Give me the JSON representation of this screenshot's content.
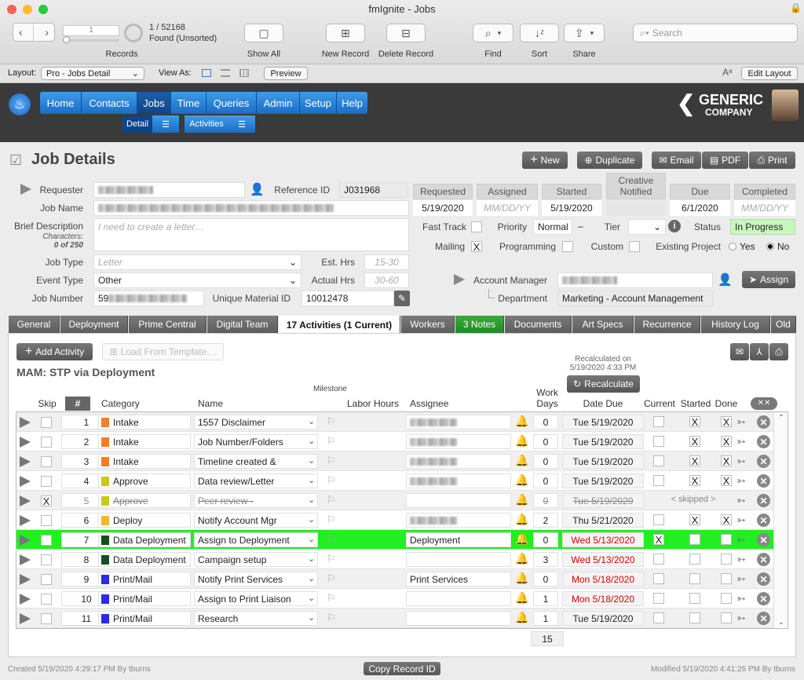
{
  "window": {
    "title": "fmIgnite - Jobs"
  },
  "toolbar": {
    "record_current": "1",
    "record_counts": "1 / 52168",
    "found_status": "Found (Unsorted)",
    "records_label": "Records",
    "show_all": "Show All",
    "new_record": "New Record",
    "delete_record": "Delete Record",
    "find": "Find",
    "sort": "Sort",
    "share": "Share",
    "search_placeholder": "Search"
  },
  "layoutbar": {
    "layout_label": "Layout:",
    "layout_value": "Pro - Jobs Detail",
    "view_as": "View As:",
    "preview": "Preview",
    "edit_layout": "Edit Layout"
  },
  "nav": {
    "items": [
      "Home",
      "Contacts",
      "Jobs",
      "Time",
      "Queries",
      "Admin",
      "Setup",
      "Help"
    ],
    "sub": [
      "Detail",
      "Activities"
    ],
    "company_line1": "GENERIC",
    "company_line2": "COMPANY"
  },
  "header": {
    "title": "Job Details",
    "new": "New",
    "duplicate": "Duplicate",
    "email": "Email",
    "pdf": "PDF",
    "print": "Print"
  },
  "form": {
    "requester_label": "Requester",
    "reference_label": "Reference ID",
    "reference_value": "J031968",
    "job_name_label": "Job Name",
    "brief_label": "Brief Description",
    "chars_label": "Characters:",
    "chars_value": "0 of 250",
    "brief_placeholder": "I need to create a letter…",
    "job_type_label": "Job Type",
    "job_type_placeholder": "Letter",
    "est_hrs_label": "Est. Hrs",
    "est_hrs_placeholder": "15-30",
    "event_type_label": "Event Type",
    "event_type_value": "Other",
    "actual_hrs_label": "Actual Hrs",
    "actual_hrs_placeholder": "30-60",
    "job_number_label": "Job Number",
    "job_number_prefix": "59",
    "material_label": "Unique Material ID",
    "material_value": "10012478"
  },
  "dates": {
    "requested_label": "Requested",
    "requested_value": "5/19/2020",
    "assigned_label": "Assigned",
    "assigned_placeholder": "MM/DD/YY",
    "started_label": "Started",
    "started_value": "5/19/2020",
    "creative_label": "Creative Notified",
    "due_label": "Due",
    "due_value": "6/1/2020",
    "completed_label": "Completed",
    "completed_placeholder": "MM/DD/YY"
  },
  "status": {
    "fast_track": "Fast Track",
    "priority_label": "Priority",
    "priority_value": "Normal",
    "priority_dash": "–",
    "tier_label": "Tier",
    "status_label": "Status",
    "status_value": "In Progress",
    "mailing": "Mailing",
    "mailing_check": "X",
    "programming": "Programming",
    "custom": "Custom",
    "existing_project": "Existing Project",
    "yes": "Yes",
    "no": "No",
    "info": "i"
  },
  "account": {
    "manager_label": "Account Manager",
    "assign": "Assign",
    "department_label": "Department",
    "department_value": "Marketing - Account Management"
  },
  "tabs": [
    "General",
    "Deployment",
    "Prime Central",
    "Digital Team",
    "17 Activities (1 Current)",
    "Workers",
    "3 Notes",
    "Documents",
    "Art Specs",
    "Recurrence",
    "History Log",
    "Old"
  ],
  "activities": {
    "add_activity": "Add Activity",
    "load_template": "Load From Template…",
    "section_title": "MAM: STP via Deployment",
    "recalc_note1": "Recalculated on",
    "recalc_note2": "5/19/2020 4:33 PM",
    "recalculate": "Recalculate",
    "milestone": "Milestone",
    "total_days": "15",
    "headers": {
      "skip": "Skip",
      "num": "#",
      "category": "Category",
      "name": "Name",
      "labor_hours": "Labor Hours",
      "assignee": "Assignee",
      "work_days": "Work Days",
      "date_due": "Date Due",
      "current": "Current",
      "started": "Started",
      "done": "Done"
    },
    "rows": [
      {
        "num": "1",
        "color": "#f07f2a",
        "category": "Intake",
        "name": "1557 Disclaimer",
        "assignee": "",
        "days": "0",
        "due": "Tue 5/19/2020",
        "started": "X",
        "done": "X",
        "bell": "gold",
        "masked": true,
        "skip": "",
        "current": "",
        "style": "alt",
        "due_red": false,
        "strike": false,
        "skipped": ""
      },
      {
        "num": "2",
        "color": "#f07f2a",
        "category": "Intake",
        "name": "Job Number/Folders",
        "assignee": "",
        "days": "0",
        "due": "Tue 5/19/2020",
        "started": "X",
        "done": "X",
        "bell": "gray",
        "masked": true,
        "skip": "",
        "current": "",
        "style": "",
        "due_red": false,
        "strike": false,
        "skipped": ""
      },
      {
        "num": "3",
        "color": "#f07f2a",
        "category": "Intake",
        "name": "Timeline created &",
        "assignee": "",
        "days": "0",
        "due": "Tue 5/19/2020",
        "started": "X",
        "done": "X",
        "bell": "gray",
        "masked": true,
        "skip": "",
        "current": "",
        "style": "alt",
        "due_red": false,
        "strike": false,
        "skipped": ""
      },
      {
        "num": "4",
        "color": "#c8c81e",
        "category": "Approve",
        "name": "Data review/Letter",
        "assignee": "",
        "days": "0",
        "due": "Tue 5/19/2020",
        "started": "X",
        "done": "X",
        "bell": "gray",
        "masked": true,
        "skip": "",
        "current": "",
        "style": "",
        "due_red": false,
        "strike": false,
        "skipped": ""
      },
      {
        "num": "5",
        "color": "#c8c81e",
        "category": "Approve",
        "name": "Peer review -",
        "assignee": "",
        "days": "0",
        "due": "Tue 5/19/2020",
        "started": "",
        "done": "",
        "bell": "gold",
        "masked": false,
        "skip": "X",
        "current": "",
        "style": "alt",
        "due_red": false,
        "strike": true,
        "skipped": "< skipped >"
      },
      {
        "num": "6",
        "color": "#f5b731",
        "category": "Deploy",
        "name": "Notify Account Mgr",
        "assignee": "",
        "days": "2",
        "due": "Thu 5/21/2020",
        "started": "X",
        "done": "X",
        "bell": "gold",
        "masked": true,
        "skip": "",
        "current": "",
        "style": "",
        "due_red": false,
        "strike": false,
        "skipped": ""
      },
      {
        "num": "7",
        "color": "#14501e",
        "category": "Data Deployment",
        "name": "Assign to Deployment",
        "assignee": "Deployment",
        "days": "0",
        "due": "Wed 5/13/2020",
        "started": "",
        "done": "",
        "bell": "gold",
        "masked": false,
        "skip": "",
        "current": "X",
        "style": "hl",
        "due_red": true,
        "strike": false,
        "skipped": ""
      },
      {
        "num": "8",
        "color": "#14501e",
        "category": "Data Deployment",
        "name": "Campaign setup",
        "assignee": "",
        "days": "3",
        "due": "Wed 5/13/2020",
        "started": "",
        "done": "",
        "bell": "gold",
        "masked": false,
        "skip": "",
        "current": "",
        "style": "",
        "due_red": true,
        "strike": false,
        "skipped": ""
      },
      {
        "num": "9",
        "color": "#2a2ae8",
        "category": "Print/Mail",
        "name": "Notify Print Services",
        "assignee": "Print Services",
        "days": "0",
        "due": "Mon 5/18/2020",
        "started": "",
        "done": "",
        "bell": "gold",
        "masked": false,
        "skip": "",
        "current": "",
        "style": "alt",
        "due_red": true,
        "strike": false,
        "skipped": ""
      },
      {
        "num": "10",
        "color": "#2a2ae8",
        "category": "Print/Mail",
        "name": "Assign to Print Liaison",
        "assignee": "",
        "days": "1",
        "due": "Mon 5/18/2020",
        "started": "",
        "done": "",
        "bell": "gold",
        "masked": false,
        "skip": "",
        "current": "",
        "style": "",
        "due_red": true,
        "strike": false,
        "skipped": ""
      },
      {
        "num": "11",
        "color": "#2a2ae8",
        "category": "Print/Mail",
        "name": "Research",
        "assignee": "",
        "days": "1",
        "due": "Tue 5/19/2020",
        "started": "",
        "done": "",
        "bell": "gray",
        "masked": false,
        "skip": "",
        "current": "",
        "style": "alt",
        "due_red": false,
        "strike": false,
        "skipped": ""
      }
    ]
  },
  "footer": {
    "created": "Created 5/19/2020 4:29:17 PM By tburns",
    "copy_record": "Copy Record ID",
    "modified": "Modified 5/19/2020 4:41:26 PM By tburns"
  }
}
